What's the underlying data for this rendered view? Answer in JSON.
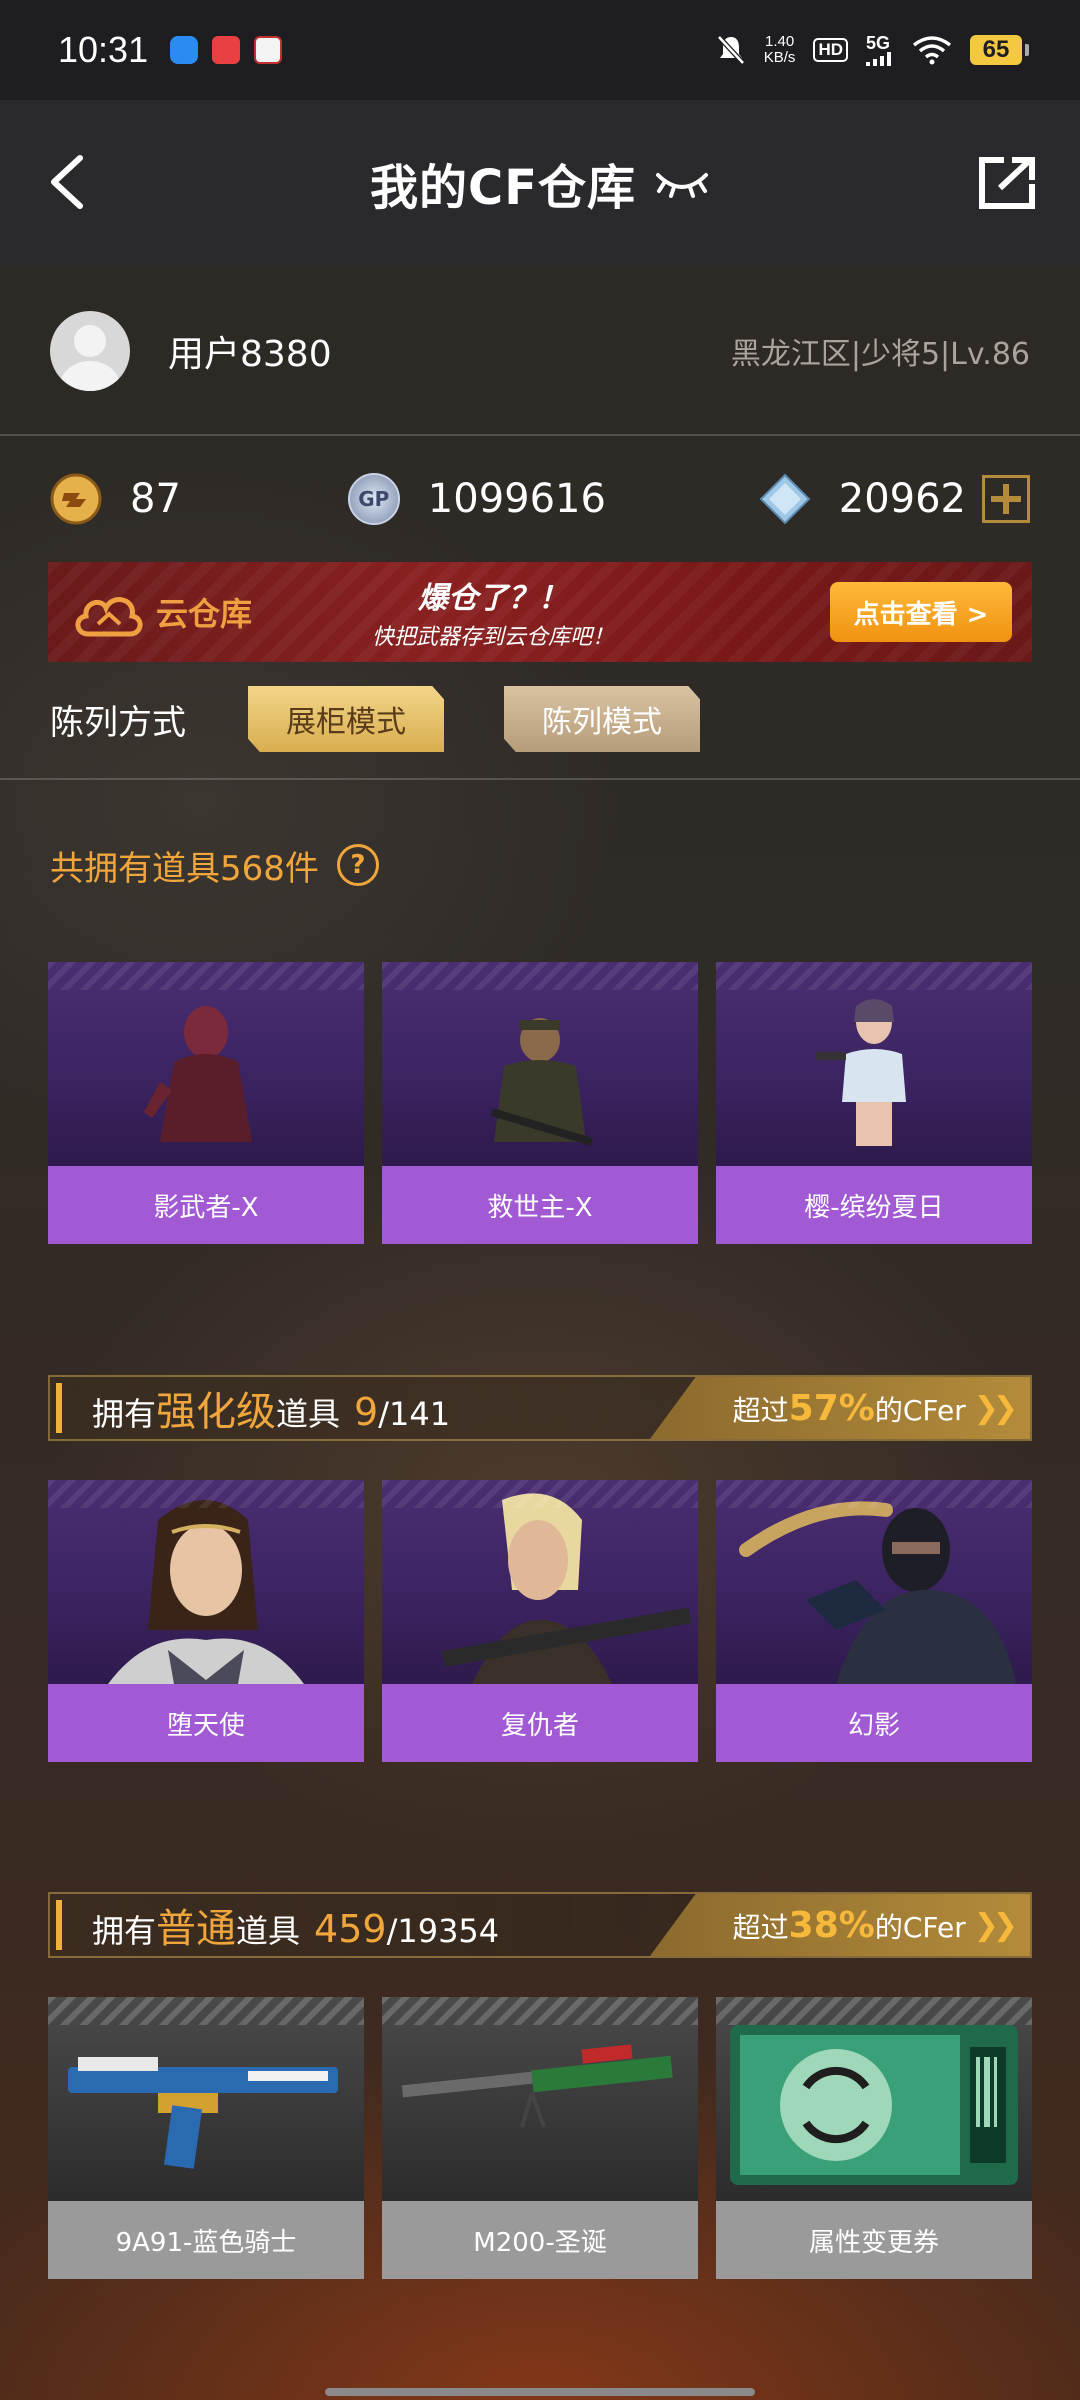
{
  "status": {
    "time": "10:31",
    "net_speed_value": "1.40",
    "net_speed_unit": "KB/s",
    "hd": "HD",
    "signal": "5G",
    "battery": "65"
  },
  "nav": {
    "title": "我的CF仓库"
  },
  "user": {
    "name": "用户8380",
    "region": "黑龙江区|少将5|Lv.86"
  },
  "currency": {
    "cf_points": "87",
    "gp": "1099616",
    "gp_icon_label": "GP",
    "diamonds": "20962"
  },
  "banner": {
    "brand": "云仓库",
    "slogan_line1": "爆仓了？！",
    "slogan_line2": "快把武器存到云仓库吧！",
    "button": "点击查看 >"
  },
  "display_mode": {
    "label": "陈列方式",
    "options": [
      "展柜模式",
      "陈列模式"
    ],
    "selected": "展柜模式"
  },
  "total": {
    "text": "共拥有道具568件",
    "help": "?"
  },
  "featured": [
    {
      "name": "影武者-X"
    },
    {
      "name": "救世主-X"
    },
    {
      "name": "樱-缤纷夏日"
    }
  ],
  "enhanced": {
    "prefix": "拥有",
    "accent": "强化级",
    "suffix": "道具",
    "count": "9",
    "total": "/141",
    "pct_prefix": "超过",
    "pct": "57%",
    "pct_suffix": "的CFer",
    "items": [
      {
        "name": "堕天使"
      },
      {
        "name": "复仇者"
      },
      {
        "name": "幻影"
      }
    ]
  },
  "normal": {
    "prefix": "拥有",
    "accent": "普通",
    "suffix": "道具",
    "count": "459",
    "total": "/19354",
    "pct_prefix": "超过",
    "pct": "38%",
    "pct_suffix": "的CFer",
    "items": [
      {
        "name": "9A91-蓝色骑士"
      },
      {
        "name": "M200-圣诞"
      },
      {
        "name": "属性变更券"
      }
    ]
  },
  "colors": {
    "accent_gold": "#f0a63c",
    "card_purple": "#a259d4",
    "card_gray": "#9a9a9a",
    "banner_red": "#8a2020",
    "button_orange": "#f09210"
  }
}
